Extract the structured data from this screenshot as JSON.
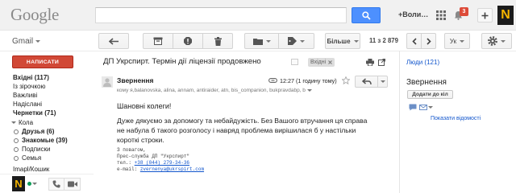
{
  "header": {
    "logo": "Google",
    "search_value": "",
    "account_name": "+Воли…",
    "notification_count": "3",
    "avatar_letter": "N"
  },
  "toolbar": {
    "app_label": "Gmail",
    "more_label": "Більше",
    "pagination": "11 з 2 879",
    "language_label": "Ук"
  },
  "sidebar": {
    "compose_label": "НАПИСАТИ",
    "folders": [
      {
        "label": "Вхідні (117)",
        "bold": true
      },
      {
        "label": "Із зірочкою",
        "bold": false
      },
      {
        "label": "Важливі",
        "bold": false
      },
      {
        "label": "Надіслані",
        "bold": false
      },
      {
        "label": "Чернетки (71)",
        "bold": true
      }
    ],
    "circles_label": "Кола",
    "circles": [
      {
        "label": "Друзья (6)",
        "bold": true
      },
      {
        "label": "Знакомые (39)",
        "bold": true
      },
      {
        "label": "Подписки",
        "bold": false
      },
      {
        "label": "Семья",
        "bold": false
      }
    ],
    "trash_label": "Imapl/Кошик",
    "chat_avatar_letter": "N",
    "chat_status": "online"
  },
  "message": {
    "subject": "ДП Укрспирт. Термін дії ліцензії продовжено",
    "label_tag": "Вхідні",
    "sender": "Звернення",
    "time": "12:27 (1 годину тому)",
    "recipients": "кому я,balanovska, alina, annam, antiraider, atn, bis_companion, bukpravdabp, b",
    "greeting": "Шановні колеги!",
    "body_lines": [
      "Дуже дякуємо за допомогу та небайдужість. Без Вашого втручання ця справа",
      "не набула б такого розголосу і навряд проблема вирішилася б у настільки",
      "короткі строки."
    ],
    "signature": {
      "closing": "З повагом,",
      "org": "Прес-служба ДП \"Укрспирт\"",
      "phone_label": "тел.:",
      "phone": "+38 (044) 279-34-36",
      "email_label": "e-mail:",
      "email": "zvernenya@ukrspirt.com"
    }
  },
  "people": {
    "title": "Люди (121)",
    "contact_name": "Звернення",
    "add_to_circles_label": "Додати до кіл",
    "show_details_label": "Показати відомості"
  },
  "icons": {
    "search": "search-icon",
    "apps": "apps-grid-icon",
    "notifications": "bell-icon",
    "share": "plus-icon",
    "back": "back-arrow-icon",
    "archive": "archive-icon",
    "spam": "spam-icon",
    "delete": "trash-icon",
    "move": "folder-icon",
    "labels": "tag-icon",
    "settings": "gear-icon",
    "print": "print-icon",
    "new_window": "new-window-icon",
    "star": "star-icon",
    "reply": "reply-icon",
    "phone": "phone-icon",
    "video": "video-icon",
    "chat": "chat-icon",
    "mail": "mail-icon"
  },
  "colors": {
    "compose": "#d14836",
    "search_button": "#4d90fe",
    "badge": "#dd4b39",
    "link": "#1155cc",
    "online": "#0f9d58",
    "avatar_letter": "#f4b400"
  }
}
